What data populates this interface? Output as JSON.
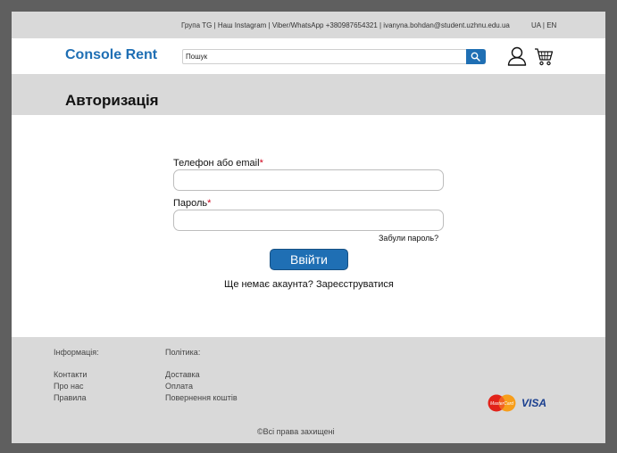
{
  "topbar": {
    "contacts": "Група TG | Наш Instagram | Viber/WhatsApp +380987654321 | ivanyna.bohdan@student.uzhnu.edu.ua",
    "lang": "UA | EN"
  },
  "header": {
    "logo": "Console Rent",
    "search_placeholder": "Пошук",
    "icons": [
      "search-icon",
      "user-icon",
      "cart-icon"
    ]
  },
  "page": {
    "title": "Авторизація"
  },
  "form": {
    "login_label": "Телефон або email",
    "password_label": "Пароль",
    "required_mark": "*",
    "forgot_password": "Забули пароль?",
    "submit": "Ввійти",
    "register_text": "Ще немає акаунта? Зареєструватися"
  },
  "footer": {
    "info_heading": "Інформація:",
    "info_links": [
      "Контакти",
      "Про нас",
      "Правила"
    ],
    "policy_heading": "Політика:",
    "policy_links": [
      "Доставка",
      "Оплата",
      "Повернення коштів"
    ],
    "payment_mastercard": "MasterCard",
    "payment_visa": "VISA",
    "copyright": "©Всі права захищені"
  },
  "colors": {
    "brand": "#1f6fb4",
    "band": "#d9d9d9",
    "required": "#d0021b"
  }
}
